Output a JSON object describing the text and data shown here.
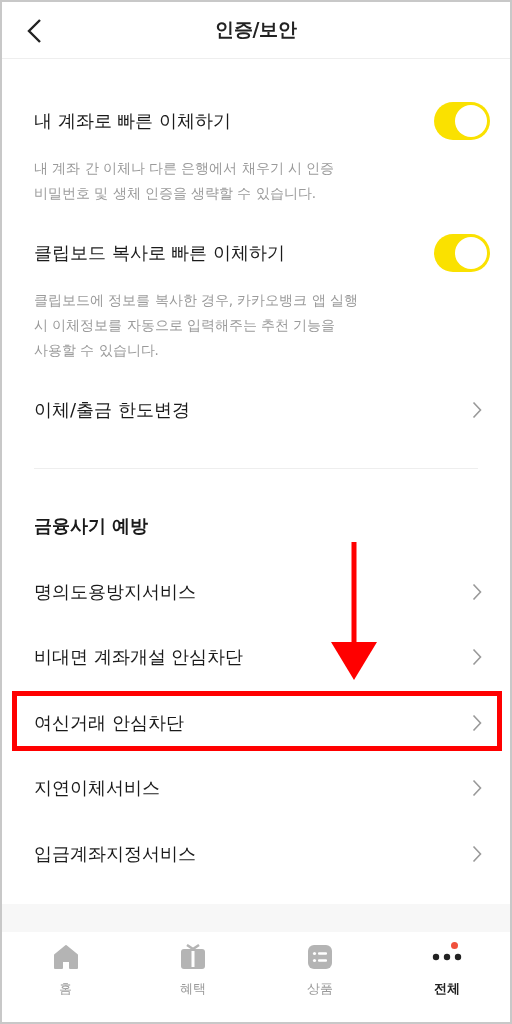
{
  "header": {
    "title": "인증/보안"
  },
  "toggles": [
    {
      "label": "내 계좌로 빠른 이체하기",
      "on": true,
      "description": "내 계좌 간 이체나 다른 은행에서 채우기 시 인증\n비밀번호 및 생체 인증을 생략할 수 있습니다."
    },
    {
      "label": "클립보드 복사로 빠른 이체하기",
      "on": true,
      "description": "클립보드에 정보를 복사한 경우, 카카오뱅크 앱 실행\n시 이체정보를 자동으로 입력해주는 추천 기능을\n사용할 수 있습니다."
    }
  ],
  "limit_item": {
    "label": "이체/출금 한도변경"
  },
  "section": {
    "title": "금융사기 예방",
    "items": [
      {
        "label": "명의도용방지서비스",
        "highlighted": false
      },
      {
        "label": "비대면 계좌개설 안심차단",
        "highlighted": false
      },
      {
        "label": "여신거래 안심차단",
        "highlighted": true
      },
      {
        "label": "지연이체서비스",
        "highlighted": false
      },
      {
        "label": "입금계좌지정서비스",
        "highlighted": false
      }
    ]
  },
  "tabs": [
    {
      "label": "홈",
      "kind": "home",
      "selected": false,
      "dot": false
    },
    {
      "label": "혜택",
      "kind": "gift",
      "selected": false,
      "dot": false
    },
    {
      "label": "상품",
      "kind": "list",
      "selected": false,
      "dot": false
    },
    {
      "label": "전체",
      "kind": "more",
      "selected": true,
      "dot": true
    }
  ]
}
